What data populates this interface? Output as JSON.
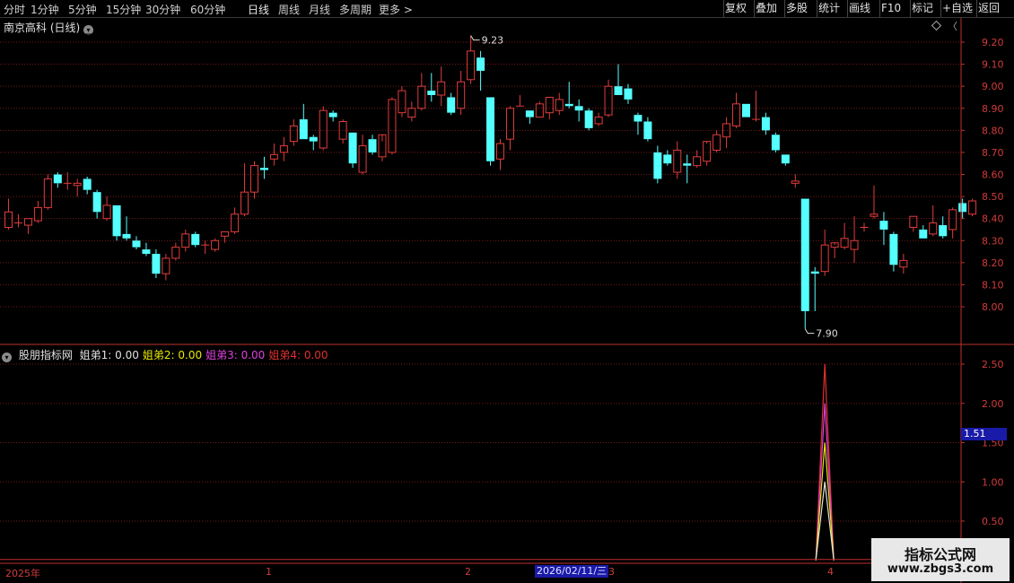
{
  "toolbar": {
    "periods": [
      "分时",
      "1分钟",
      "5分钟",
      "15分钟",
      "30分钟",
      "60分钟",
      "日线",
      "周线",
      "月线",
      "多周期",
      "更多"
    ],
    "active_period": "日线",
    "right_buttons": [
      "复权",
      "叠加",
      "多股",
      "统计",
      "画线",
      "F10",
      "标记",
      "+自选",
      "返回"
    ]
  },
  "stock": {
    "title": "南京高科 (日线)"
  },
  "price_axis": {
    "ticks": [
      "9.20",
      "9.10",
      "9.00",
      "8.90",
      "8.80",
      "8.70",
      "8.60",
      "8.50",
      "8.40",
      "8.30",
      "8.20",
      "8.10",
      "8.00"
    ]
  },
  "annotations": {
    "high": "9.23",
    "low": "7.90"
  },
  "indicator": {
    "name": "股朋指标网",
    "series": [
      {
        "label": "姐弟1:",
        "value": "0.00",
        "color": "#e0e0e0"
      },
      {
        "label": "姐弟2:",
        "value": "0.00",
        "color": "#e8e800"
      },
      {
        "label": "姐弟3:",
        "value": "0.00",
        "color": "#e040e0"
      },
      {
        "label": "姐弟4:",
        "value": "0.00",
        "color": "#e03030"
      }
    ],
    "ticks": [
      "2.50",
      "2.00",
      "1.50",
      "1.00",
      "0.50"
    ],
    "crosshair_value": "1.51"
  },
  "date_axis": {
    "labels": [
      "2025年",
      "1",
      "2",
      "3",
      "4"
    ],
    "cursor_date": "2026/02/11/三"
  },
  "watermark": {
    "title": "指标公式网",
    "url": "www.zbgs3.com"
  },
  "colors": {
    "up": "#e03c3c",
    "down": "#54ffff",
    "grid": "#7a1a1a",
    "axis": "#c03030"
  },
  "chart_data": {
    "type": "candlestick",
    "series_order": "oldest to newest",
    "candles": [
      {
        "o": 8.36,
        "h": 8.49,
        "l": 8.35,
        "c": 8.43
      },
      {
        "o": 8.38,
        "h": 8.42,
        "l": 8.36,
        "c": 8.38
      },
      {
        "o": 8.37,
        "h": 8.4,
        "l": 8.33,
        "c": 8.4
      },
      {
        "o": 8.39,
        "h": 8.48,
        "l": 8.38,
        "c": 8.45
      },
      {
        "o": 8.45,
        "h": 8.6,
        "l": 8.44,
        "c": 8.58
      },
      {
        "o": 8.6,
        "h": 8.61,
        "l": 8.54,
        "c": 8.56
      },
      {
        "o": 8.56,
        "h": 8.61,
        "l": 8.53,
        "c": 8.56
      },
      {
        "o": 8.55,
        "h": 8.58,
        "l": 8.5,
        "c": 8.56
      },
      {
        "o": 8.58,
        "h": 8.59,
        "l": 8.51,
        "c": 8.53
      },
      {
        "o": 8.52,
        "h": 8.53,
        "l": 8.4,
        "c": 8.43
      },
      {
        "o": 8.4,
        "h": 8.5,
        "l": 8.39,
        "c": 8.46
      },
      {
        "o": 8.46,
        "h": 8.46,
        "l": 8.3,
        "c": 8.32
      },
      {
        "o": 8.33,
        "h": 8.41,
        "l": 8.3,
        "c": 8.31
      },
      {
        "o": 8.3,
        "h": 8.32,
        "l": 8.26,
        "c": 8.27
      },
      {
        "o": 8.26,
        "h": 8.29,
        "l": 8.23,
        "c": 8.24
      },
      {
        "o": 8.24,
        "h": 8.26,
        "l": 8.13,
        "c": 8.15
      },
      {
        "o": 8.15,
        "h": 8.24,
        "l": 8.12,
        "c": 8.22
      },
      {
        "o": 8.22,
        "h": 8.29,
        "l": 8.21,
        "c": 8.27
      },
      {
        "o": 8.27,
        "h": 8.35,
        "l": 8.25,
        "c": 8.33
      },
      {
        "o": 8.33,
        "h": 8.34,
        "l": 8.27,
        "c": 8.28
      },
      {
        "o": 8.28,
        "h": 8.3,
        "l": 8.24,
        "c": 8.28
      },
      {
        "o": 8.26,
        "h": 8.31,
        "l": 8.25,
        "c": 8.3
      },
      {
        "o": 8.32,
        "h": 8.34,
        "l": 8.29,
        "c": 8.34
      },
      {
        "o": 8.34,
        "h": 8.45,
        "l": 8.33,
        "c": 8.42
      },
      {
        "o": 8.42,
        "h": 8.65,
        "l": 8.41,
        "c": 8.52
      },
      {
        "o": 8.52,
        "h": 8.66,
        "l": 8.49,
        "c": 8.64
      },
      {
        "o": 8.63,
        "h": 8.68,
        "l": 8.58,
        "c": 8.62
      },
      {
        "o": 8.67,
        "h": 8.74,
        "l": 8.64,
        "c": 8.69
      },
      {
        "o": 8.7,
        "h": 8.77,
        "l": 8.66,
        "c": 8.73
      },
      {
        "o": 8.75,
        "h": 8.85,
        "l": 8.73,
        "c": 8.82
      },
      {
        "o": 8.85,
        "h": 8.92,
        "l": 8.76,
        "c": 8.76
      },
      {
        "o": 8.77,
        "h": 8.78,
        "l": 8.71,
        "c": 8.75
      },
      {
        "o": 8.72,
        "h": 8.91,
        "l": 8.71,
        "c": 8.89
      },
      {
        "o": 8.88,
        "h": 8.89,
        "l": 8.84,
        "c": 8.86
      },
      {
        "o": 8.76,
        "h": 8.85,
        "l": 8.74,
        "c": 8.84
      },
      {
        "o": 8.79,
        "h": 8.79,
        "l": 8.63,
        "c": 8.65
      },
      {
        "o": 8.61,
        "h": 8.78,
        "l": 8.6,
        "c": 8.73
      },
      {
        "o": 8.76,
        "h": 8.78,
        "l": 8.69,
        "c": 8.7
      },
      {
        "o": 8.68,
        "h": 8.75,
        "l": 8.66,
        "c": 8.78
      },
      {
        "o": 8.7,
        "h": 8.95,
        "l": 8.69,
        "c": 8.94
      },
      {
        "o": 8.88,
        "h": 9.0,
        "l": 8.86,
        "c": 8.98
      },
      {
        "o": 8.86,
        "h": 8.93,
        "l": 8.84,
        "c": 8.9
      },
      {
        "o": 8.9,
        "h": 9.06,
        "l": 8.89,
        "c": 9.0
      },
      {
        "o": 8.98,
        "h": 9.06,
        "l": 8.93,
        "c": 8.96
      },
      {
        "o": 8.96,
        "h": 9.09,
        "l": 8.91,
        "c": 9.02
      },
      {
        "o": 8.95,
        "h": 8.97,
        "l": 8.87,
        "c": 8.88
      },
      {
        "o": 8.9,
        "h": 9.07,
        "l": 8.87,
        "c": 9.02
      },
      {
        "o": 9.03,
        "h": 9.23,
        "l": 9.01,
        "c": 9.16
      },
      {
        "o": 9.13,
        "h": 9.16,
        "l": 8.98,
        "c": 9.07
      },
      {
        "o": 8.95,
        "h": 8.95,
        "l": 8.64,
        "c": 8.66
      },
      {
        "o": 8.67,
        "h": 8.76,
        "l": 8.62,
        "c": 8.74
      },
      {
        "o": 8.76,
        "h": 8.91,
        "l": 8.71,
        "c": 8.9
      },
      {
        "o": 8.91,
        "h": 8.96,
        "l": 8.91,
        "c": 8.91
      },
      {
        "o": 8.89,
        "h": 8.89,
        "l": 8.83,
        "c": 8.86
      },
      {
        "o": 8.86,
        "h": 8.93,
        "l": 8.86,
        "c": 8.92
      },
      {
        "o": 8.88,
        "h": 8.95,
        "l": 8.85,
        "c": 8.95
      },
      {
        "o": 8.89,
        "h": 8.97,
        "l": 8.87,
        "c": 8.94
      },
      {
        "o": 8.92,
        "h": 9.02,
        "l": 8.9,
        "c": 8.91
      },
      {
        "o": 8.91,
        "h": 8.94,
        "l": 8.84,
        "c": 8.89
      },
      {
        "o": 8.89,
        "h": 8.9,
        "l": 8.8,
        "c": 8.81
      },
      {
        "o": 8.83,
        "h": 8.88,
        "l": 8.82,
        "c": 8.86
      },
      {
        "o": 8.87,
        "h": 9.03,
        "l": 8.86,
        "c": 9.0
      },
      {
        "o": 9.0,
        "h": 9.1,
        "l": 8.96,
        "c": 8.96
      },
      {
        "o": 8.99,
        "h": 9.01,
        "l": 8.92,
        "c": 8.94
      },
      {
        "o": 8.87,
        "h": 8.88,
        "l": 8.78,
        "c": 8.84
      },
      {
        "o": 8.84,
        "h": 8.86,
        "l": 8.75,
        "c": 8.76
      },
      {
        "o": 8.7,
        "h": 8.73,
        "l": 8.56,
        "c": 8.58
      },
      {
        "o": 8.69,
        "h": 8.71,
        "l": 8.64,
        "c": 8.65
      },
      {
        "o": 8.61,
        "h": 8.75,
        "l": 8.58,
        "c": 8.71
      },
      {
        "o": 8.65,
        "h": 8.69,
        "l": 8.56,
        "c": 8.64
      },
      {
        "o": 8.64,
        "h": 8.71,
        "l": 8.63,
        "c": 8.68
      },
      {
        "o": 8.66,
        "h": 8.74,
        "l": 8.64,
        "c": 8.75
      },
      {
        "o": 8.71,
        "h": 8.8,
        "l": 8.7,
        "c": 8.78
      },
      {
        "o": 8.77,
        "h": 8.86,
        "l": 8.72,
        "c": 8.83
      },
      {
        "o": 8.82,
        "h": 8.97,
        "l": 8.81,
        "c": 8.92
      },
      {
        "o": 8.92,
        "h": 8.92,
        "l": 8.86,
        "c": 8.86
      },
      {
        "o": 8.85,
        "h": 8.98,
        "l": 8.84,
        "c": 8.85
      },
      {
        "o": 8.86,
        "h": 8.88,
        "l": 8.78,
        "c": 8.8
      },
      {
        "o": 8.78,
        "h": 8.79,
        "l": 8.7,
        "c": 8.71
      },
      {
        "o": 8.69,
        "h": 8.69,
        "l": 8.64,
        "c": 8.65
      },
      {
        "o": 8.56,
        "h": 8.6,
        "l": 8.54,
        "c": 8.57
      },
      {
        "o": 8.49,
        "h": 8.49,
        "l": 7.9,
        "c": 7.98
      },
      {
        "o": 8.16,
        "h": 8.18,
        "l": 7.98,
        "c": 8.15
      },
      {
        "o": 8.16,
        "h": 8.35,
        "l": 8.14,
        "c": 8.28
      },
      {
        "o": 8.27,
        "h": 8.28,
        "l": 8.22,
        "c": 8.29
      },
      {
        "o": 8.27,
        "h": 8.38,
        "l": 8.26,
        "c": 8.31
      },
      {
        "o": 8.26,
        "h": 8.41,
        "l": 8.2,
        "c": 8.3
      },
      {
        "o": 8.36,
        "h": 8.38,
        "l": 8.34,
        "c": 8.36
      },
      {
        "o": 8.41,
        "h": 8.55,
        "l": 8.4,
        "c": 8.42
      },
      {
        "o": 8.39,
        "h": 8.43,
        "l": 8.28,
        "c": 8.35
      },
      {
        "o": 8.33,
        "h": 8.34,
        "l": 8.16,
        "c": 8.19
      },
      {
        "o": 8.18,
        "h": 8.24,
        "l": 8.15,
        "c": 8.21
      },
      {
        "o": 8.36,
        "h": 8.41,
        "l": 8.34,
        "c": 8.41
      },
      {
        "o": 8.35,
        "h": 8.37,
        "l": 8.31,
        "c": 8.31
      },
      {
        "o": 8.33,
        "h": 8.46,
        "l": 8.32,
        "c": 8.38
      },
      {
        "o": 8.37,
        "h": 8.41,
        "l": 8.31,
        "c": 8.32
      },
      {
        "o": 8.35,
        "h": 8.45,
        "l": 8.31,
        "c": 8.44
      },
      {
        "o": 8.47,
        "h": 8.49,
        "l": 8.4,
        "c": 8.43
      },
      {
        "o": 8.42,
        "h": 8.49,
        "l": 8.41,
        "c": 8.48
      }
    ],
    "indicator": {
      "spike_index": 83,
      "lines": [
        {
          "name": "姐弟1",
          "peak": 1.0,
          "color": "#e0e0e0"
        },
        {
          "name": "姐弟2",
          "peak": 1.5,
          "color": "#e8e800"
        },
        {
          "name": "姐弟3",
          "peak": 2.0,
          "color": "#e040e0"
        },
        {
          "name": "姐弟4",
          "peak": 2.5,
          "color": "#e03030"
        }
      ]
    }
  }
}
